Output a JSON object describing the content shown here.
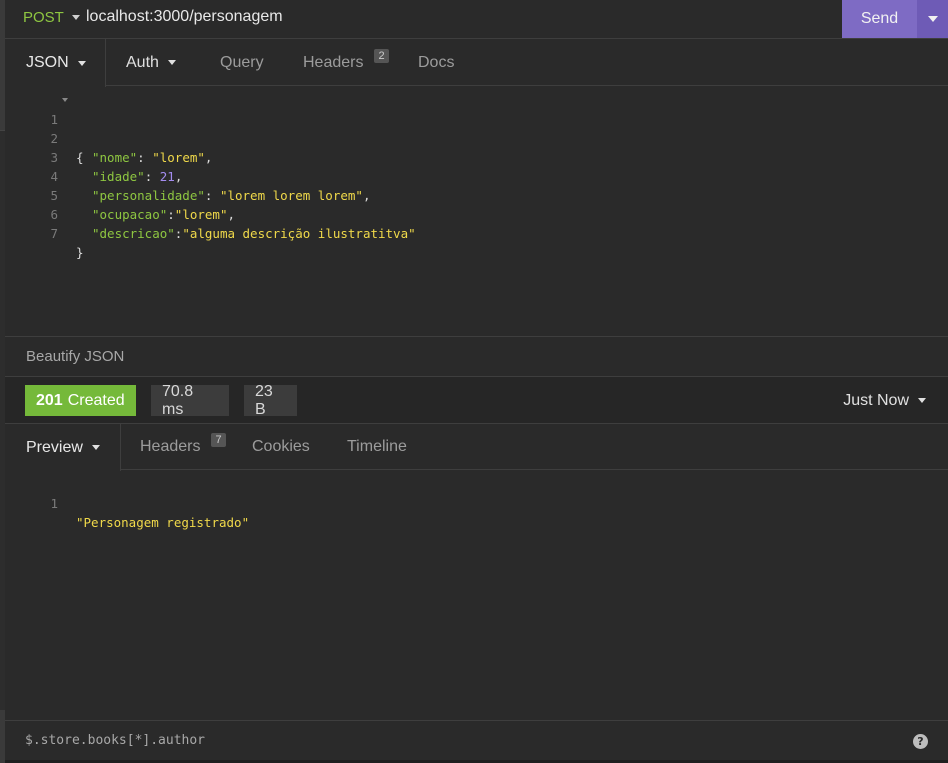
{
  "request": {
    "method": "POST",
    "url": "localhost:3000/personagem",
    "send_label": "Send"
  },
  "request_tabs": {
    "json": "JSON",
    "auth": "Auth",
    "query": "Query",
    "headers": "Headers",
    "headers_count": "2",
    "docs": "Docs"
  },
  "request_body": {
    "line_numbers": [
      "1",
      "2",
      "3",
      "4",
      "5",
      "6",
      "7"
    ],
    "open_brace": "{",
    "close_brace": "}",
    "fields": [
      {
        "key": "\"nome\"",
        "sep": ": ",
        "value": "\"lorem\"",
        "trail": ","
      },
      {
        "key": "\"idade\"",
        "sep": ": ",
        "value": "21",
        "trail": ","
      },
      {
        "key": "\"personalidade\"",
        "sep": ": ",
        "value": "\"lorem lorem lorem\"",
        "trail": ","
      },
      {
        "key": "\"ocupacao\"",
        "sep": ":",
        "value": "\"lorem\"",
        "trail": ","
      },
      {
        "key": "\"descricao\"",
        "sep": ":",
        "value": "\"alguma descrição ilustratitva\"",
        "trail": ""
      }
    ]
  },
  "beautify_label": "Beautify JSON",
  "response": {
    "status_code": "201",
    "status_text": "Created",
    "time": "70.8 ms",
    "size": "23 B",
    "when": "Just Now"
  },
  "response_tabs": {
    "preview": "Preview",
    "headers": "Headers",
    "headers_count": "7",
    "cookies": "Cookies",
    "timeline": "Timeline"
  },
  "response_body": {
    "line_number": "1",
    "text": "\"Personagem registrado\""
  },
  "filter": {
    "placeholder": "$.store.books[*].author",
    "help": "?"
  },
  "colors": {
    "accent": "#7e6bc4",
    "success": "#75b93a",
    "method": "#8ec641",
    "string": "#f0d94a",
    "number": "#a48cf0"
  }
}
